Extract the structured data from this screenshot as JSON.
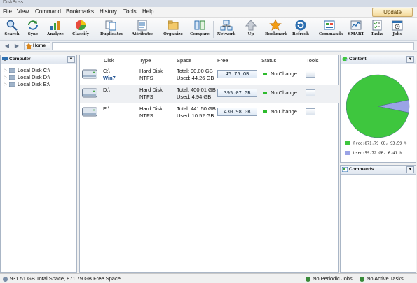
{
  "window": {
    "title": "DiskBoss"
  },
  "menu": {
    "items": [
      "File",
      "View",
      "Command",
      "Bookmarks",
      "History",
      "Tools",
      "Help"
    ],
    "update": "Update"
  },
  "toolbar": {
    "buttons": [
      {
        "label": "Search",
        "icon": "search-icon"
      },
      {
        "label": "Sync",
        "icon": "sync-icon"
      },
      {
        "label": "Analyze",
        "icon": "analyze-icon"
      },
      {
        "label": "Classify",
        "icon": "classify-icon"
      },
      {
        "label": "Duplicates",
        "icon": "duplicates-icon"
      },
      {
        "label": "Attributes",
        "icon": "attributes-icon"
      },
      {
        "label": "Organize",
        "icon": "organize-icon"
      },
      {
        "label": "Compare",
        "icon": "compare-icon"
      },
      {
        "label": "Network",
        "icon": "network-icon"
      },
      {
        "label": "Up",
        "icon": "up-icon"
      },
      {
        "label": "Bookmark",
        "icon": "bookmark-icon"
      },
      {
        "label": "Refresh",
        "icon": "refresh-icon"
      },
      {
        "label": "Commands",
        "icon": "commands-icon"
      },
      {
        "label": "SMART",
        "icon": "smart-icon"
      },
      {
        "label": "Tasks",
        "icon": "tasks-icon"
      },
      {
        "label": "Jobs",
        "icon": "jobs-icon"
      }
    ]
  },
  "address": {
    "home": "Home",
    "value": ""
  },
  "left_panel": {
    "title": "Computer",
    "items": [
      "Local Disk C:\\",
      "Local Disk D:\\",
      "Local Disk E:\\"
    ]
  },
  "table": {
    "columns": [
      "Disk",
      "Type",
      "Space",
      "Free",
      "Status",
      "Tools"
    ],
    "rows": [
      {
        "disk": "C:\\",
        "label": "Win7",
        "type": "Hard Disk",
        "fs": "NTFS",
        "total": "Total: 90.00 GB",
        "used": "Used: 44.26 GB",
        "free": "45.75 GB",
        "status": "No Change"
      },
      {
        "disk": "D:\\",
        "label": "",
        "type": "Hard Disk",
        "fs": "NTFS",
        "total": "Total: 400.01 GB",
        "used": "Used: 4.94 GB",
        "free": "395.07 GB",
        "status": "No Change"
      },
      {
        "disk": "E:\\",
        "label": "",
        "type": "Hard Disk",
        "fs": "NTFS",
        "total": "Total: 441.50 GB",
        "used": "Used: 10.52 GB",
        "free": "430.98 GB",
        "status": "No Change"
      }
    ]
  },
  "right_panel": {
    "content_title": "Content",
    "commands_title": "Commands",
    "legend": [
      {
        "label": "Free:871.79 GB, 93.59 %",
        "color": "#3ec63e"
      },
      {
        "label": "Used:59.72 GB, 6.41 %",
        "color": "#9aa3e6"
      }
    ]
  },
  "chart_data": {
    "type": "pie",
    "values": [
      871.79,
      59.72
    ],
    "percent": [
      93.59,
      6.41
    ],
    "categories": [
      "Free",
      "Used"
    ],
    "colors": [
      "#3ec63e",
      "#9aa3e6"
    ]
  },
  "status": {
    "summary": "931.51 GB Total Space, 871.79 GB Free Space",
    "jobs": "No Periodic Jobs",
    "tasks": "No Active Tasks"
  }
}
